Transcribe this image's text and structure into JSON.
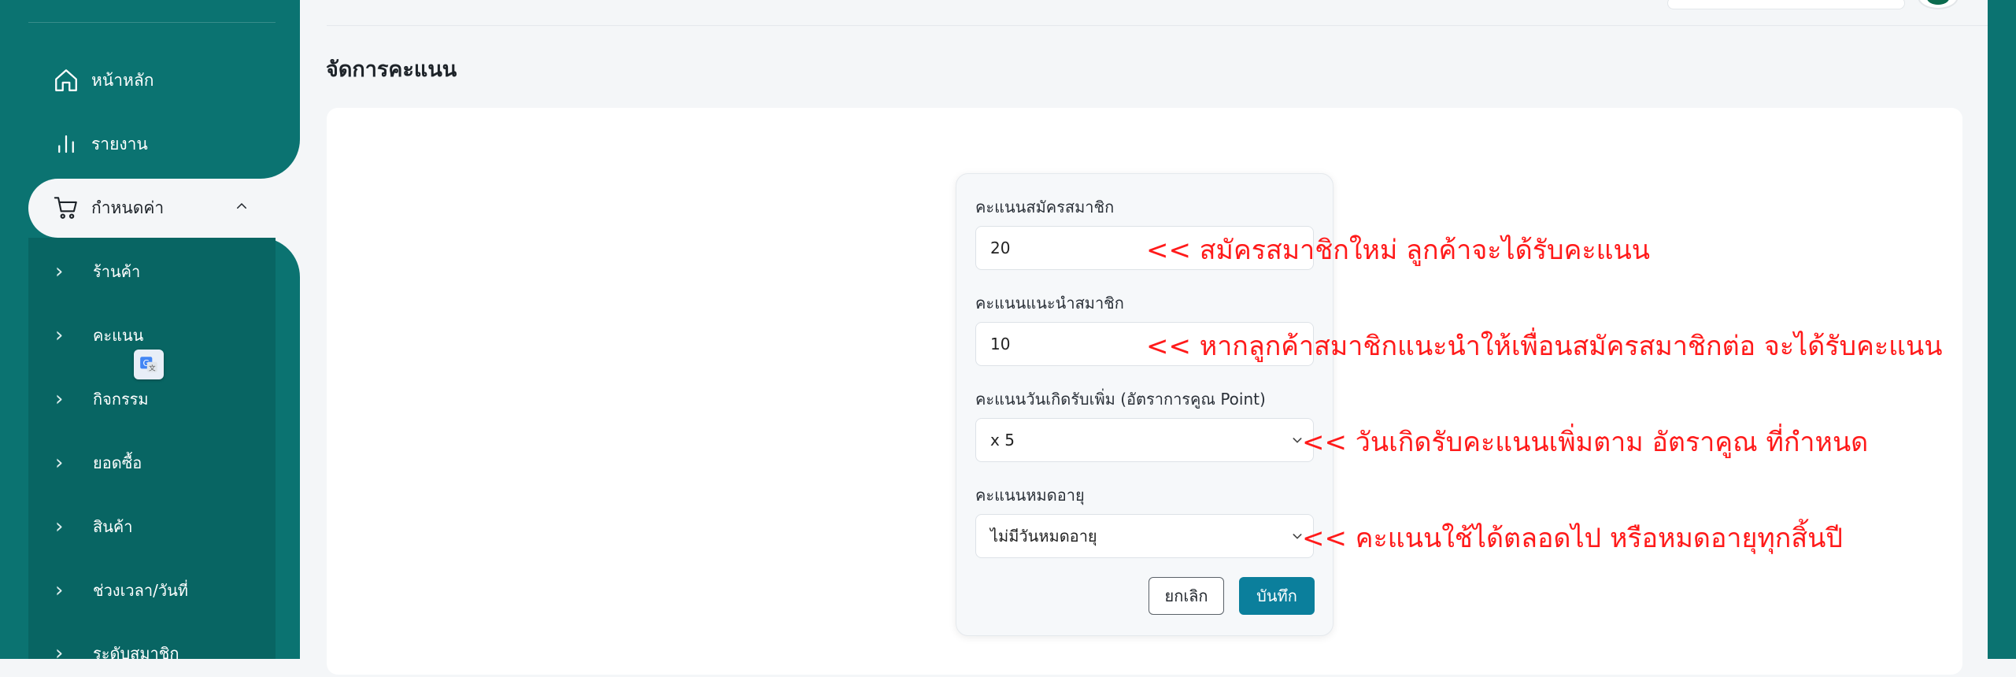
{
  "sidebar": {
    "items": [
      {
        "label": "หน้าหลัก",
        "icon": "home-icon"
      },
      {
        "label": "รายงาน",
        "icon": "bar-chart-icon"
      },
      {
        "label": "กำหนดค่า",
        "icon": "cart-icon",
        "expanded": true
      }
    ],
    "submenu": [
      {
        "label": "ร้านค้า"
      },
      {
        "label": "คะแนน"
      },
      {
        "label": "กิจกรรม"
      },
      {
        "label": "ยอดซื้อ"
      },
      {
        "label": "สินค้า"
      },
      {
        "label": "ช่วงเวลา/วันที่"
      },
      {
        "label": "ระดับสมาชิก"
      }
    ]
  },
  "page": {
    "title": "จัดการคะแนน"
  },
  "form": {
    "fields": [
      {
        "label": "คะแนนสมัครสมาชิก",
        "value": "20"
      },
      {
        "label": "คะแนนแนะนำสมาชิก",
        "value": "10"
      },
      {
        "label": "คะแนนวันเกิดรับเพิ่ม (อัตราการคูณ Point)",
        "value": "x 5"
      },
      {
        "label": "คะแนนหมดอายุ",
        "value": "ไม่มีวันหมดอายุ"
      }
    ],
    "cancel_label": "ยกเลิก",
    "save_label": "บันทึก"
  },
  "annotations": [
    "<< สมัครสมาชิกใหม่ ลูกค้าจะได้รับคะแนน",
    "<< หากลูกค้าสมาชิกแนะนำให้เพื่อนสมัครสมาชิกต่อ จะได้รับคะแนน",
    "<< วันเกิดรับคะแนนเพิ่มตาม อัตราคูณ ที่กำหนด",
    "<< คะแนนใช้ได้ตลอดไป หรือหมดอายุทุกสิ้นปี"
  ],
  "colors": {
    "sidebar": "#0b7371",
    "submenu": "#086563",
    "primary_button": "#0b7f9c",
    "annotation": "#ff1a1a"
  }
}
